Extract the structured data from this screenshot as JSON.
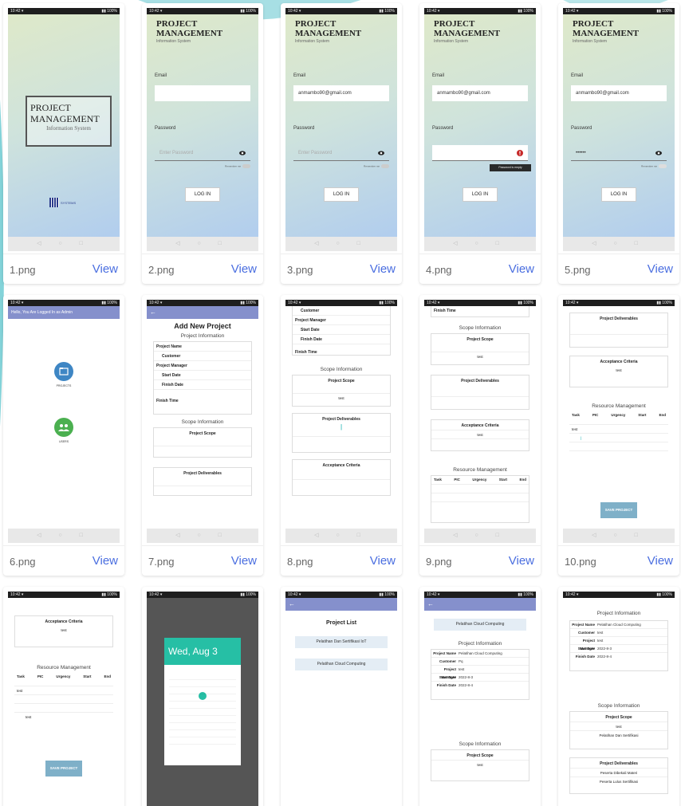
{
  "gallery": {
    "view_label": "View",
    "items": [
      {
        "file": "1.png"
      },
      {
        "file": "2.png"
      },
      {
        "file": "3.png"
      },
      {
        "file": "4.png"
      },
      {
        "file": "5.png"
      },
      {
        "file": "6.png"
      },
      {
        "file": "7.png"
      },
      {
        "file": "8.png"
      },
      {
        "file": "9.png"
      },
      {
        "file": "10.png"
      }
    ]
  },
  "screens": {
    "splash": {
      "title": "PROJECT MANAGEMENT",
      "subtitle": "Information System",
      "logo_text": "SYSTEMS"
    },
    "login": {
      "title_line1": "PROJECT",
      "title_line2": "MANAGEMENT",
      "subtitle": "Information System",
      "email_label": "Email",
      "password_label": "Password",
      "password_placeholder": "Enter Password",
      "email_value": "anmambo90@gmail.com",
      "password_dots": "••••••",
      "remember_label": "Remember me",
      "login_button": "LOG IN",
      "tooltip": "Password is empty"
    },
    "menu": {
      "header": "Hello, You Are Logged In as Admin",
      "item1_label": "PROJECTS",
      "item2_label": "USERS"
    },
    "add_project": {
      "title": "Add New Project",
      "project_info": "Project Information",
      "fields": [
        "Project Name",
        "Customer",
        "Project Manager",
        "Start Date",
        "Finish Date",
        "Finish Time"
      ],
      "scope_info": "Scope Information",
      "project_scope": "Project Scope",
      "project_deliverables": "Project Deliverables",
      "acceptance_criteria": "Acceptance Criteria",
      "resource_management": "Resource Management",
      "resource_columns": [
        "Task",
        "PIC",
        "Urgency",
        "Start",
        "End"
      ],
      "test_value": "test",
      "save_button": "SAVE PROJECT"
    }
  }
}
